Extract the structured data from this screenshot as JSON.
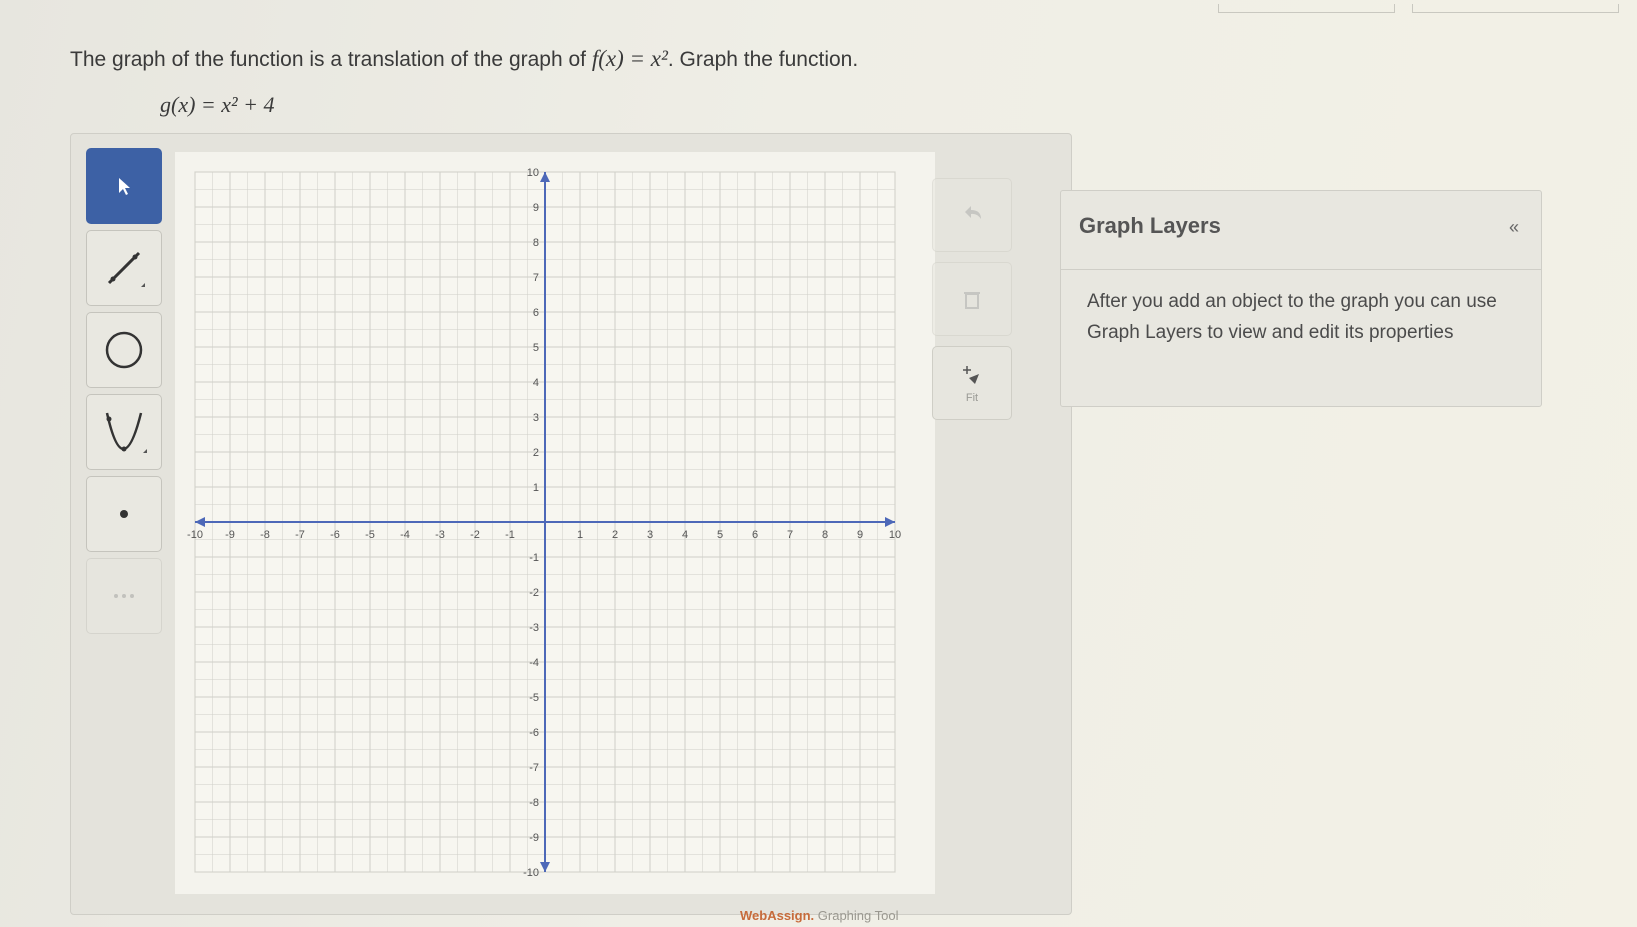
{
  "prompt": {
    "text_before": "The graph of the function is a translation of the graph of ",
    "base_function": "f(x) = x²",
    "text_after": ". Graph the function.",
    "target_function": "g(x) = x² + 4"
  },
  "toolbar": {
    "tools": [
      {
        "name": "select-tool",
        "icon": "pointer-icon"
      },
      {
        "name": "line-tool",
        "icon": "line-icon"
      },
      {
        "name": "circle-tool",
        "icon": "circle-icon"
      },
      {
        "name": "parabola-tool",
        "icon": "parabola-icon"
      },
      {
        "name": "point-tool",
        "icon": "point-icon"
      }
    ]
  },
  "side_buttons": {
    "undo_icon": "undo-icon",
    "delete_icon": "trash-icon",
    "fit_label": "Fit"
  },
  "graph": {
    "xlim": [
      -10,
      10
    ],
    "ylim": [
      -10,
      10
    ],
    "x_ticks": [
      -10,
      -9,
      -8,
      -7,
      -6,
      -5,
      -4,
      -3,
      -2,
      -1,
      1,
      2,
      3,
      4,
      5,
      6,
      7,
      8,
      9,
      10
    ],
    "y_ticks": [
      10,
      9,
      8,
      7,
      6,
      5,
      4,
      3,
      2,
      1,
      -1,
      -2,
      -3,
      -4,
      -5,
      -6,
      -7,
      -8,
      -9,
      -10
    ],
    "grid": true
  },
  "graph_layers": {
    "title": "Graph Layers",
    "description": "After you add an object to the graph you can use Graph Layers to view and edit its properties"
  },
  "footer": {
    "brand": "WebAssign.",
    "suffix": " Graphing Tool"
  },
  "colors": {
    "accent": "#3d61a5",
    "axis": "#4d68b8",
    "grid": "#cfcfc8"
  }
}
